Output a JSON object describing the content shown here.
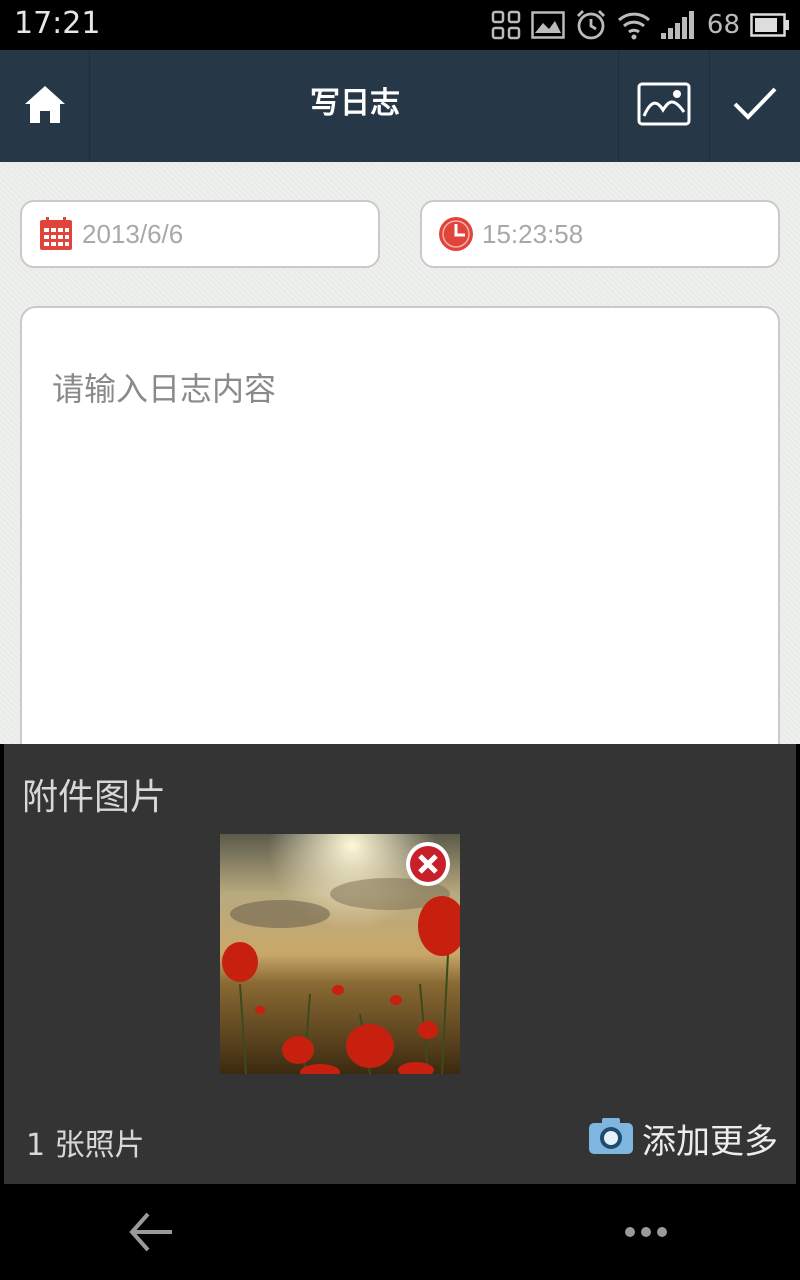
{
  "status_bar": {
    "time": "17:21",
    "battery_level": "68",
    "icons": [
      "qr-scan-icon",
      "image-notification-icon",
      "alarm-icon",
      "wifi-icon",
      "signal-icon",
      "battery-icon"
    ]
  },
  "header": {
    "title": "写日志",
    "home_icon": "home-icon",
    "image_icon": "image-icon",
    "confirm_icon": "checkmark-icon",
    "background_color": "#263848"
  },
  "form": {
    "date_value": "2013/6/6",
    "time_value": "15:23:58",
    "content_placeholder": "请输入日志内容",
    "accent_color": "#e0443a"
  },
  "attachments": {
    "title": "附件图片",
    "photo_count_text": "1 张照片",
    "add_more_label": "添加更多",
    "photos": [
      {
        "name": "poppy-field-photo"
      }
    ]
  },
  "nav_bar": {
    "icons": [
      "back-arrow-icon",
      "more-dots-icon"
    ]
  }
}
